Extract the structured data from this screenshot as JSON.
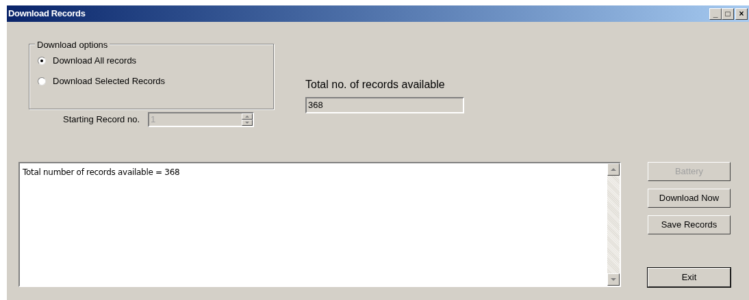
{
  "window": {
    "title": "Download Records",
    "controls": [
      "_",
      "□",
      "×"
    ]
  },
  "download_options": {
    "legend": "Download options",
    "options": [
      {
        "label": "Download All records",
        "selected": true
      },
      {
        "label": "Download Selected Records",
        "selected": false
      }
    ]
  },
  "starting_record": {
    "label": "Starting Record no.",
    "value": "1",
    "disabled": true
  },
  "total_records": {
    "label": "Total no. of records available",
    "value": "368"
  },
  "log": {
    "lines": [
      "Total number of records available = 368"
    ]
  },
  "buttons": [
    {
      "label": "Battery",
      "disabled": true,
      "default": false
    },
    {
      "label": "Download Now",
      "disabled": false,
      "default": false
    },
    {
      "label": "Save Records",
      "disabled": false,
      "default": false
    },
    {
      "label": "Exit",
      "disabled": false,
      "default": true
    }
  ]
}
